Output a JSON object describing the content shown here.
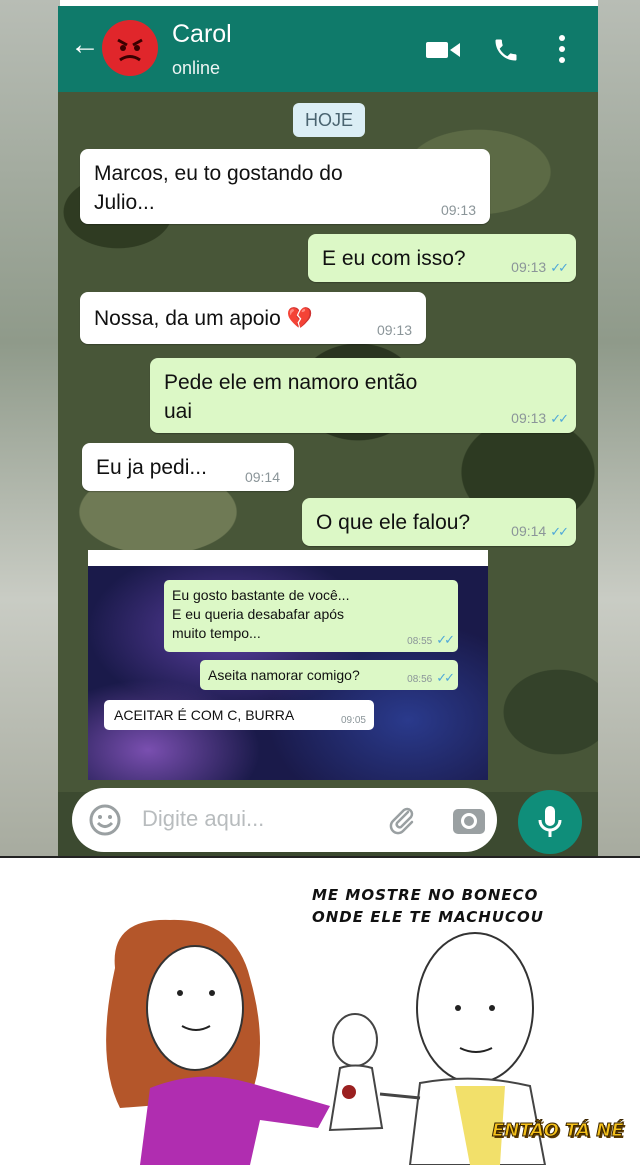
{
  "header": {
    "contact_name": "Carol",
    "status": "online"
  },
  "date_chip": "HOJE",
  "messages": [
    {
      "text": "Marcos, eu to gostando do\nJulio...",
      "time": "09:13"
    },
    {
      "text": "E eu com isso?",
      "time": "09:13"
    },
    {
      "text": "Nossa, da um apoio 💔",
      "time": "09:13"
    },
    {
      "text": "Pede ele em namoro então\nuai",
      "time": "09:13"
    },
    {
      "text": "Eu ja pedi...",
      "time": "09:14"
    },
    {
      "text": "O que ele falou?",
      "time": "09:14"
    }
  ],
  "embedded": {
    "messages": [
      {
        "text": "Eu gosto bastante de você...\nE eu queria desabafar após\nmuito tempo...",
        "time": "08:55"
      },
      {
        "text": "Aseita namorar comigo?",
        "time": "08:56"
      },
      {
        "text": "ACEITAR É COM C, BURRA",
        "time": "09:05"
      }
    ]
  },
  "input": {
    "placeholder": "Digite aqui..."
  },
  "comic": {
    "caption": "ME MOSTRE NO BONECO\nONDE ELE TE MACHUCOU",
    "brand": "ENTÃO TÁ NÉ"
  },
  "colors": {
    "appbar": "#0f7a6a",
    "outgoing_bubble": "#dcf8c6",
    "incoming_bubble": "#ffffff",
    "avatar": "#e0262b",
    "mic_button": "#0f8e7a"
  },
  "icons": [
    "back-arrow-icon",
    "angry-face-icon",
    "video-call-icon",
    "phone-icon",
    "more-vert-icon",
    "emoji-icon",
    "attach-icon",
    "camera-icon",
    "mic-icon",
    "double-check-icon"
  ]
}
